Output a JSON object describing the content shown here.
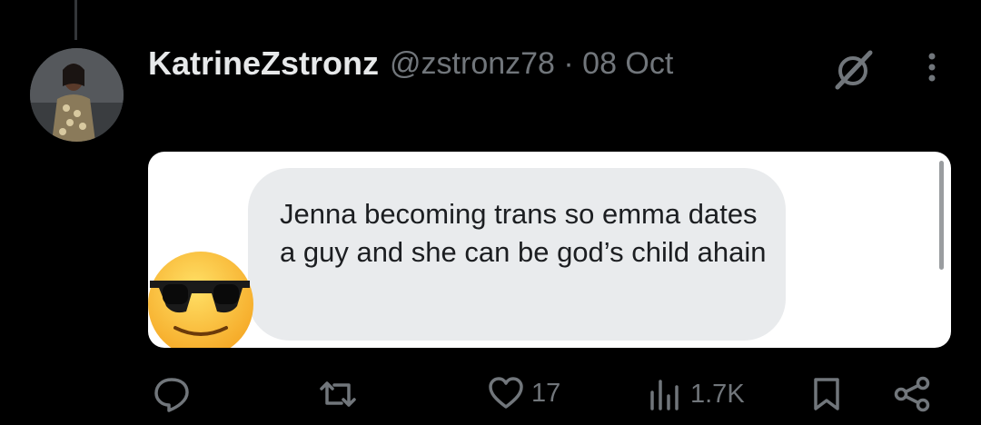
{
  "tweet": {
    "display_name": "KatrineZstronz",
    "handle": "@zstronz78",
    "separator": "·",
    "date": "08 Oct",
    "header_meta": "@zstronz78 · 08 Oct"
  },
  "media": {
    "message_text": "Jenna becoming trans so emma dates a guy and she can be god’s child ahain",
    "emoji": "smiling-face-with-sunglasses"
  },
  "actions": {
    "reply_count": "",
    "retweet_count": "",
    "like_count": "17",
    "views_count": "1.7K"
  },
  "colors": {
    "background": "#000000",
    "text_primary": "#e7e9ea",
    "text_secondary": "#71767b",
    "bubble": "#e9ebed"
  },
  "icons": [
    "grok-icon",
    "more-icon",
    "reply-icon",
    "retweet-icon",
    "like-icon",
    "views-icon",
    "bookmark-icon",
    "share-icon"
  ]
}
